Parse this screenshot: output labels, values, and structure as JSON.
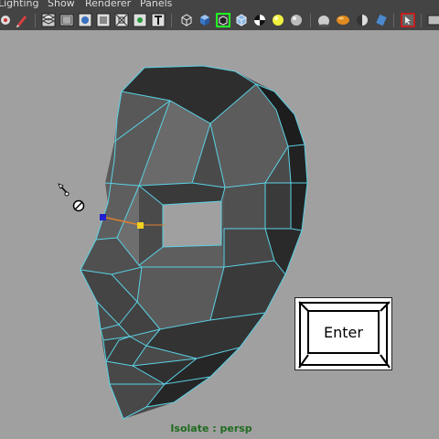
{
  "menubar": {
    "items": [
      {
        "label": "Lighting"
      },
      {
        "label": "Show"
      },
      {
        "label": "Renderer"
      },
      {
        "label": "Panels"
      }
    ]
  },
  "toolbar": {
    "icons": [
      "camera-icon",
      "pencil-icon",
      "grid-icon",
      "film-gate-icon",
      "resolution-gate-icon",
      "gate-mask-icon",
      "field-chart-icon",
      "safe-action-icon",
      "safe-title-icon",
      "text-icon",
      "wireframe-cube-icon",
      "smooth-shade-cube-icon",
      "selection-highlight-icon",
      "wireframe-on-shaded-icon",
      "checker-texture-icon",
      "light-bulb-icon",
      "default-light-icon",
      "sphere-shade-icon",
      "shadows-icon",
      "half-sphere-icon",
      "cylinder-icon",
      "isolate-select-icon",
      "xray-icon"
    ]
  },
  "viewport": {
    "hud_text": "Isolate : persp",
    "colors": {
      "background": "#a0a0a0",
      "wireframe": "#5ad2e6",
      "vertex_selected": "#2020d0",
      "vertex_hover": "#f0d020",
      "edge_tool": "#e08030"
    }
  },
  "key_overlay": {
    "label": "Enter"
  }
}
